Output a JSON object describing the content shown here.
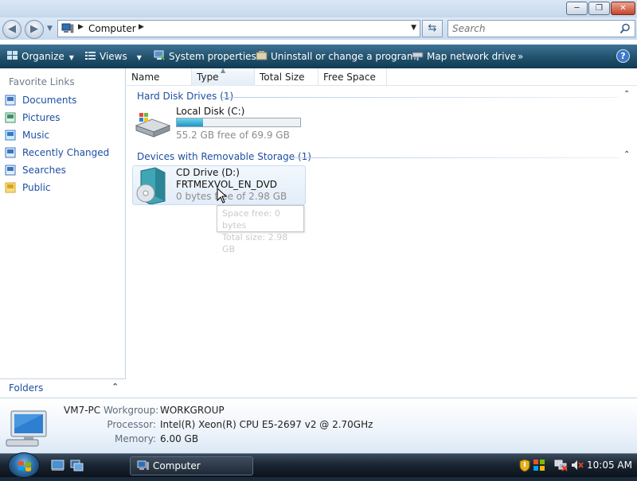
{
  "window": {
    "title_buttons": [
      "minimize",
      "maximize",
      "close"
    ]
  },
  "address_bar": {
    "location": "Computer"
  },
  "search": {
    "placeholder": "Search"
  },
  "toolbar": {
    "organize": "Organize",
    "views": "Views",
    "system_properties": "System properties",
    "uninstall": "Uninstall or change a program",
    "map_drive": "Map network drive",
    "more": "»",
    "help": "?"
  },
  "navpane": {
    "title": "Favorite Links",
    "links": [
      {
        "label": "Documents",
        "icon": "documents-icon"
      },
      {
        "label": "Pictures",
        "icon": "pictures-icon"
      },
      {
        "label": "Music",
        "icon": "music-icon"
      },
      {
        "label": "Recently Changed",
        "icon": "recent-icon"
      },
      {
        "label": "Searches",
        "icon": "searches-icon"
      },
      {
        "label": "Public",
        "icon": "public-folder-icon"
      }
    ],
    "folders": "Folders"
  },
  "columns": [
    "Name",
    "Type",
    "Total Size",
    "Free Space"
  ],
  "groups": [
    {
      "title": "Hard Disk Drives (1)",
      "items": [
        {
          "name": "Local Disk (C:)",
          "free_text": "55.2 GB free of 69.9 GB",
          "used_fraction": 0.21
        }
      ]
    },
    {
      "title": "Devices with Removable Storage (1)",
      "items": [
        {
          "name": "CD Drive (D:)",
          "label": "FRTMEXVOL_EN_DVD",
          "free_text": "0 bytes free of 2.98 GB"
        }
      ]
    }
  ],
  "tooltip": {
    "line1": "Space free: 0 bytes",
    "line2": "Total size: 2.98 GB"
  },
  "details": {
    "pc_name": "VM7-PC",
    "workgroup_label": "Workgroup:",
    "workgroup": "WORKGROUP",
    "processor_label": "Processor:",
    "processor": "Intel(R) Xeon(R) CPU E5-2697 v2 @ 2.70GHz",
    "memory_label": "Memory:",
    "memory": "6.00 GB"
  },
  "taskbar": {
    "active_window": "Computer",
    "clock": "10:05 AM"
  },
  "colors": {
    "link": "#1d4fa3",
    "toolbar": "#23546f",
    "accent": "#1f95c5"
  }
}
